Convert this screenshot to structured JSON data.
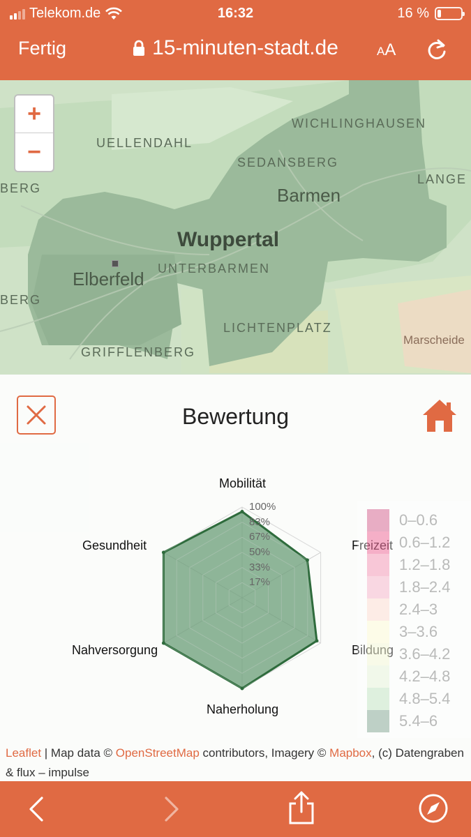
{
  "status": {
    "carrier": "Telekom.de",
    "time": "16:32",
    "battery": "16 %",
    "battery_level": 0.16
  },
  "browser": {
    "done_label": "Fertig",
    "url": "15-minuten-stadt.de",
    "text_size_label_small": "A",
    "text_size_label_big": "A"
  },
  "map": {
    "zoom_in": "+",
    "zoom_out": "−",
    "places": {
      "wichlinghausen": "WICHLINGHAUSEN",
      "uellendahl": "UELLENDAHL",
      "sedansberg": "SEDANSBERG",
      "berg_top": "BERG",
      "barmen": "Barmen",
      "lange": "LANGE",
      "wuppertal": "Wuppertal",
      "unterbarmen": "UNTERBARMEN",
      "elberfeld": "Elberfeld",
      "berg_mid": "BERG",
      "lichtenplatz": "LICHTENPLATZ",
      "grifflenberg": "GRIFFLENBERG",
      "marscheide": "Marscheide"
    }
  },
  "panel": {
    "title": "Bewertung",
    "close_icon": "close-icon",
    "home_icon": "home-icon"
  },
  "chart_data": {
    "type": "radar",
    "axes": [
      "Mobilität",
      "Freizeit",
      "Bildung",
      "Naherholung",
      "Nahversorgung",
      "Gesundheit"
    ],
    "tick_labels": [
      "17%",
      "33%",
      "50%",
      "67%",
      "83%",
      "100%"
    ],
    "range": [
      0,
      100
    ],
    "values": [
      95,
      83,
      95,
      100,
      100,
      100
    ],
    "fill_color": "#6fa07c",
    "line_color": "#2e6b3c"
  },
  "legend": {
    "items": [
      {
        "label": "0–0.6",
        "color": "#c2185b"
      },
      {
        "label": "0.6–1.2",
        "color": "#e91e63"
      },
      {
        "label": "1.2–1.8",
        "color": "#f06292"
      },
      {
        "label": "1.8–2.4",
        "color": "#f48fb1"
      },
      {
        "label": "2.4–3",
        "color": "#ffccbc"
      },
      {
        "label": "3–3.6",
        "color": "#fff9c4"
      },
      {
        "label": "3.6–4.2",
        "color": "#f0f4c3"
      },
      {
        "label": "4.2–4.8",
        "color": "#dcedc8"
      },
      {
        "label": "4.8–5.4",
        "color": "#a5d6a7"
      },
      {
        "label": "5.4–6",
        "color": "#4a7a60"
      }
    ]
  },
  "attribution": {
    "leaflet": "Leaflet",
    "sep": " | Map data © ",
    "osm": "OpenStreetMap",
    "mid": " contributors, Imagery © ",
    "mapbox": "Mapbox",
    "tail": ", (c) Datengraben & flux – impulse"
  }
}
